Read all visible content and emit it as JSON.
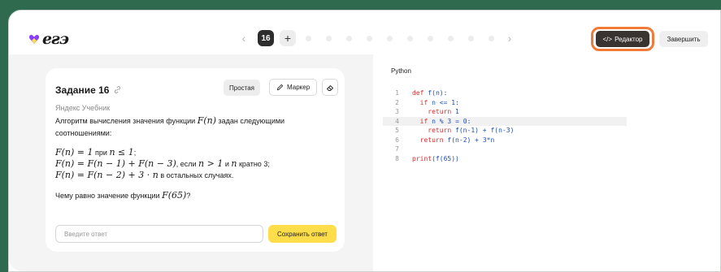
{
  "app": {
    "logo_text": "eƨэ"
  },
  "pager": {
    "prev_icon": "‹",
    "current": "16",
    "add": "+",
    "next_icon": "›",
    "dots_count": 10
  },
  "toolbar": {
    "editor_label": "Редактор",
    "editor_icon": "</>",
    "finish_label": "Завершить"
  },
  "task": {
    "title": "Задание 16",
    "difficulty": "Простая",
    "marker_label": "Маркер",
    "source": "Яндекс Учебник",
    "intro_a": "Алгоритм вычисления значения функции ",
    "intro_fn": "F(n)",
    "intro_b": " задан следующими соотношениями:",
    "rule1_math_a": "F(n) = 1",
    "rule1_text_a": " при ",
    "rule1_math_b": "n ≤ 1",
    "rule1_text_b": ";",
    "rule2_math_a": "F(n) = F(n − 1) + F(n − 3)",
    "rule2_text_a": ", если ",
    "rule2_math_b": "n > 1",
    "rule2_text_b": " и ",
    "rule2_math_c": "n",
    "rule2_text_c": " кратно 3;",
    "rule3_math_a": "F(n) = F(n − 2) + 3 · n",
    "rule3_text_a": " в остальных случаях.",
    "question_a": "Чему равно значение функции ",
    "question_math": "F(65)",
    "question_b": "?",
    "answer_placeholder": "Введите ответ",
    "save_label": "Сохранить ответ"
  },
  "code": {
    "language": "Python",
    "lines": [
      {
        "n": "1",
        "t": "def f(n):"
      },
      {
        "n": "2",
        "t": "  if n <= 1:"
      },
      {
        "n": "3",
        "t": "    return 1"
      },
      {
        "n": "4",
        "t": "  if n % 3 = 0:"
      },
      {
        "n": "5",
        "t": "    return f(n-1) + f(n-3)"
      },
      {
        "n": "6",
        "t": "  return f(n-2) + 3*n"
      },
      {
        "n": "7",
        "t": ""
      },
      {
        "n": "8",
        "t": "print(f(65))"
      }
    ],
    "highlighted_line": "4"
  }
}
